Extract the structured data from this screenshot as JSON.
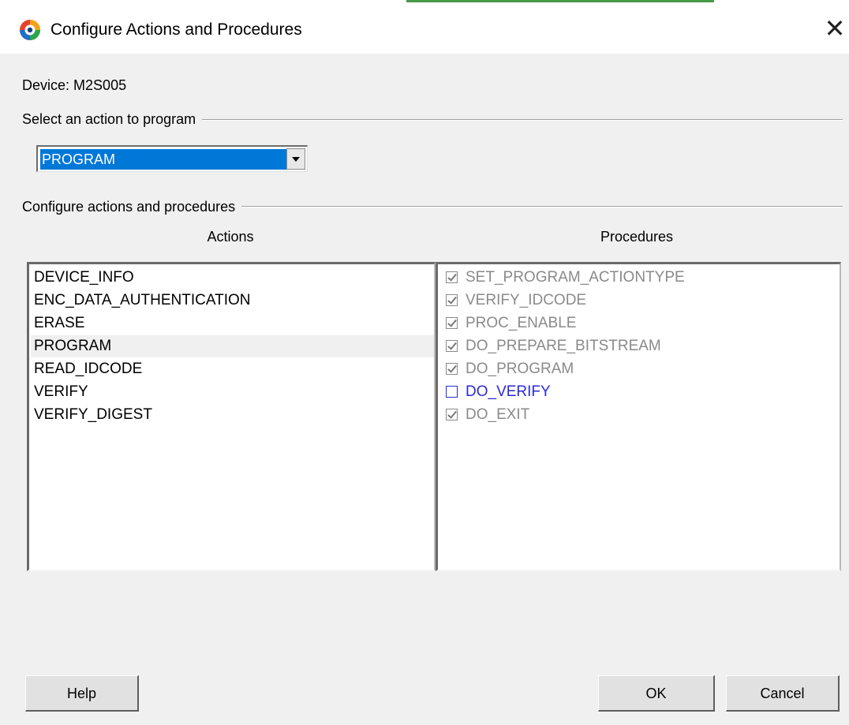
{
  "window": {
    "title": "Configure Actions and Procedures",
    "close_symbol": "✕",
    "icon": "app-logo-icon"
  },
  "device": {
    "label": "Device:",
    "value": "M2S005"
  },
  "action_group": {
    "label": "Select an action to program",
    "selected": "PROGRAM"
  },
  "config_group": {
    "label": "Configure actions and procedures",
    "actions_header": "Actions",
    "procedures_header": "Procedures"
  },
  "actions": [
    "DEVICE_INFO",
    "ENC_DATA_AUTHENTICATION",
    "ERASE",
    "PROGRAM",
    "READ_IDCODE",
    "VERIFY",
    "VERIFY_DIGEST"
  ],
  "selected_action": "PROGRAM",
  "procedures": [
    {
      "name": "SET_PROGRAM_ACTIONTYPE",
      "checked": true,
      "enabled": false
    },
    {
      "name": "VERIFY_IDCODE",
      "checked": true,
      "enabled": false
    },
    {
      "name": "PROC_ENABLE",
      "checked": true,
      "enabled": false
    },
    {
      "name": "DO_PREPARE_BITSTREAM",
      "checked": true,
      "enabled": false
    },
    {
      "name": "DO_PROGRAM",
      "checked": true,
      "enabled": false
    },
    {
      "name": "DO_VERIFY",
      "checked": false,
      "enabled": true
    },
    {
      "name": "DO_EXIT",
      "checked": true,
      "enabled": false
    }
  ],
  "buttons": {
    "help": "Help",
    "ok": "OK",
    "cancel": "Cancel"
  },
  "colors": {
    "selection": "#0078d7",
    "enabled_procedure": "#2a2ad2",
    "disabled_procedure": "#8a8a8a"
  }
}
